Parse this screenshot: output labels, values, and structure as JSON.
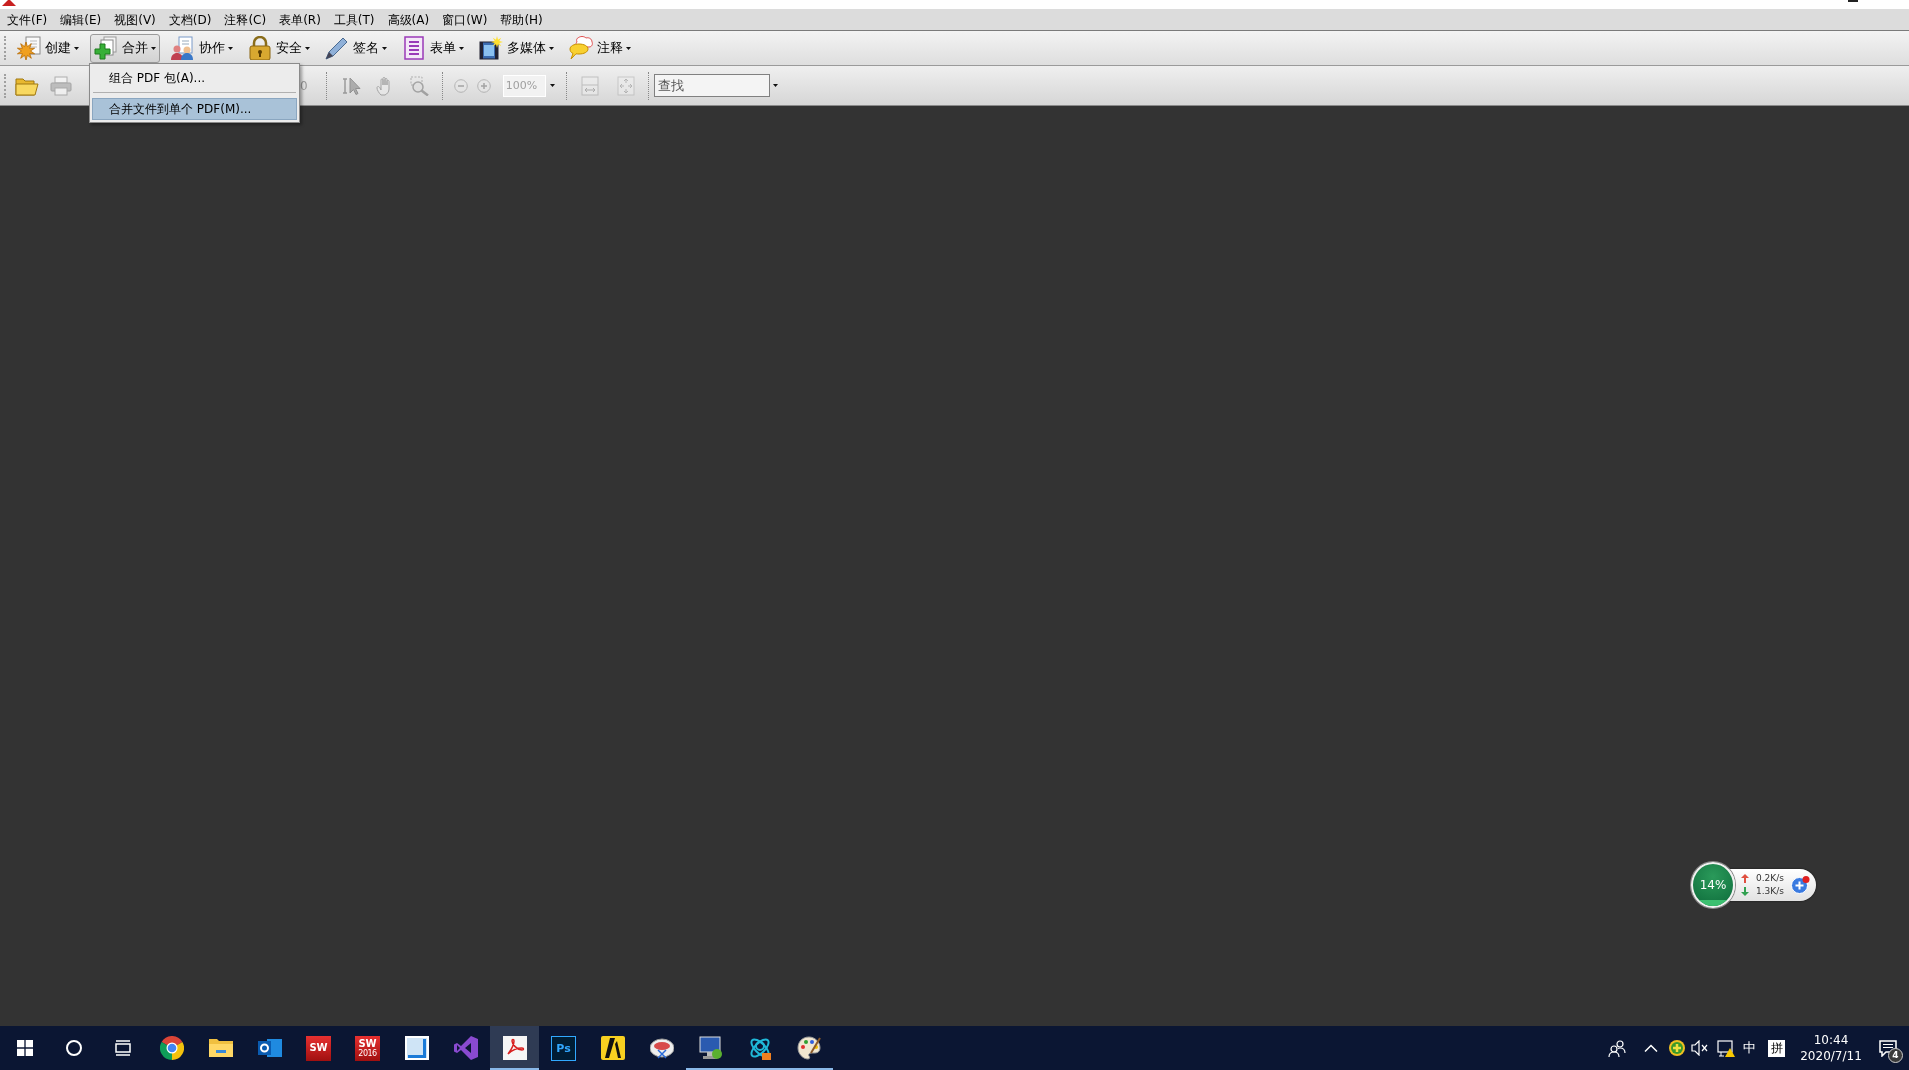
{
  "menu_bar": [
    {
      "label": "文件(F)"
    },
    {
      "label": "编辑(E)"
    },
    {
      "label": "视图(V)"
    },
    {
      "label": "文档(D)"
    },
    {
      "label": "注释(C)"
    },
    {
      "label": "表单(R)"
    },
    {
      "label": "工具(T)"
    },
    {
      "label": "高级(A)"
    },
    {
      "label": "窗口(W)"
    },
    {
      "label": "帮助(H)"
    }
  ],
  "toolbar": [
    {
      "label": "创建",
      "pressed": false
    },
    {
      "label": "合并",
      "pressed": true
    },
    {
      "label": "协作",
      "pressed": false
    },
    {
      "label": "安全",
      "pressed": false
    },
    {
      "label": "签名",
      "pressed": false
    },
    {
      "label": "表单",
      "pressed": false
    },
    {
      "label": "多媒体",
      "pressed": false
    },
    {
      "label": "注释",
      "pressed": false
    }
  ],
  "open_menu": [
    {
      "label": "组合 PDF 包(A)...",
      "selected": false
    },
    {
      "label": "合并文件到单个 PDF(M)...",
      "selected": true
    }
  ],
  "toolbar_2": {
    "tools": [
      {
        "disabled": false
      },
      {
        "disabled": true
      },
      {
        "disabled": true
      },
      {
        "disabled": true
      },
      {
        "disabled": true
      },
      {
        "disabled": true
      },
      {
        "disabled": true
      },
      {
        "disabled": true
      },
      {
        "disabled": true
      }
    ],
    "page_number": "0",
    "zoom": "100%",
    "find": {
      "placeholder": "查找"
    }
  },
  "widget": {
    "usage": "14%",
    "level": 0.14,
    "upload": "0.2K/s",
    "download": "1.3K/s"
  },
  "taskbar": {
    "apps": [
      {
        "running": false,
        "selected": false
      },
      {
        "running": false,
        "selected": false
      },
      {
        "running": false,
        "selected": false
      },
      {
        "running": false,
        "selected": false,
        "logo_text": "SW"
      },
      {
        "running": false,
        "selected": false,
        "logo_text": "SW",
        "logo_subtext": "2016"
      },
      {
        "running": false,
        "selected": false
      },
      {
        "running": false,
        "selected": false
      },
      {
        "running": true,
        "selected": true
      },
      {
        "running": false,
        "selected": false,
        "logo_text": "Ps"
      },
      {
        "running": false,
        "selected": false
      },
      {
        "running": false,
        "selected": false
      },
      {
        "running": true,
        "selected": false
      },
      {
        "running": true,
        "selected": false
      },
      {
        "running": true,
        "selected": false
      }
    ],
    "tray": {
      "input_mode": "中",
      "ime": "拼",
      "time": "10:44",
      "date": "2020/7/11",
      "notification_count": "4"
    }
  }
}
